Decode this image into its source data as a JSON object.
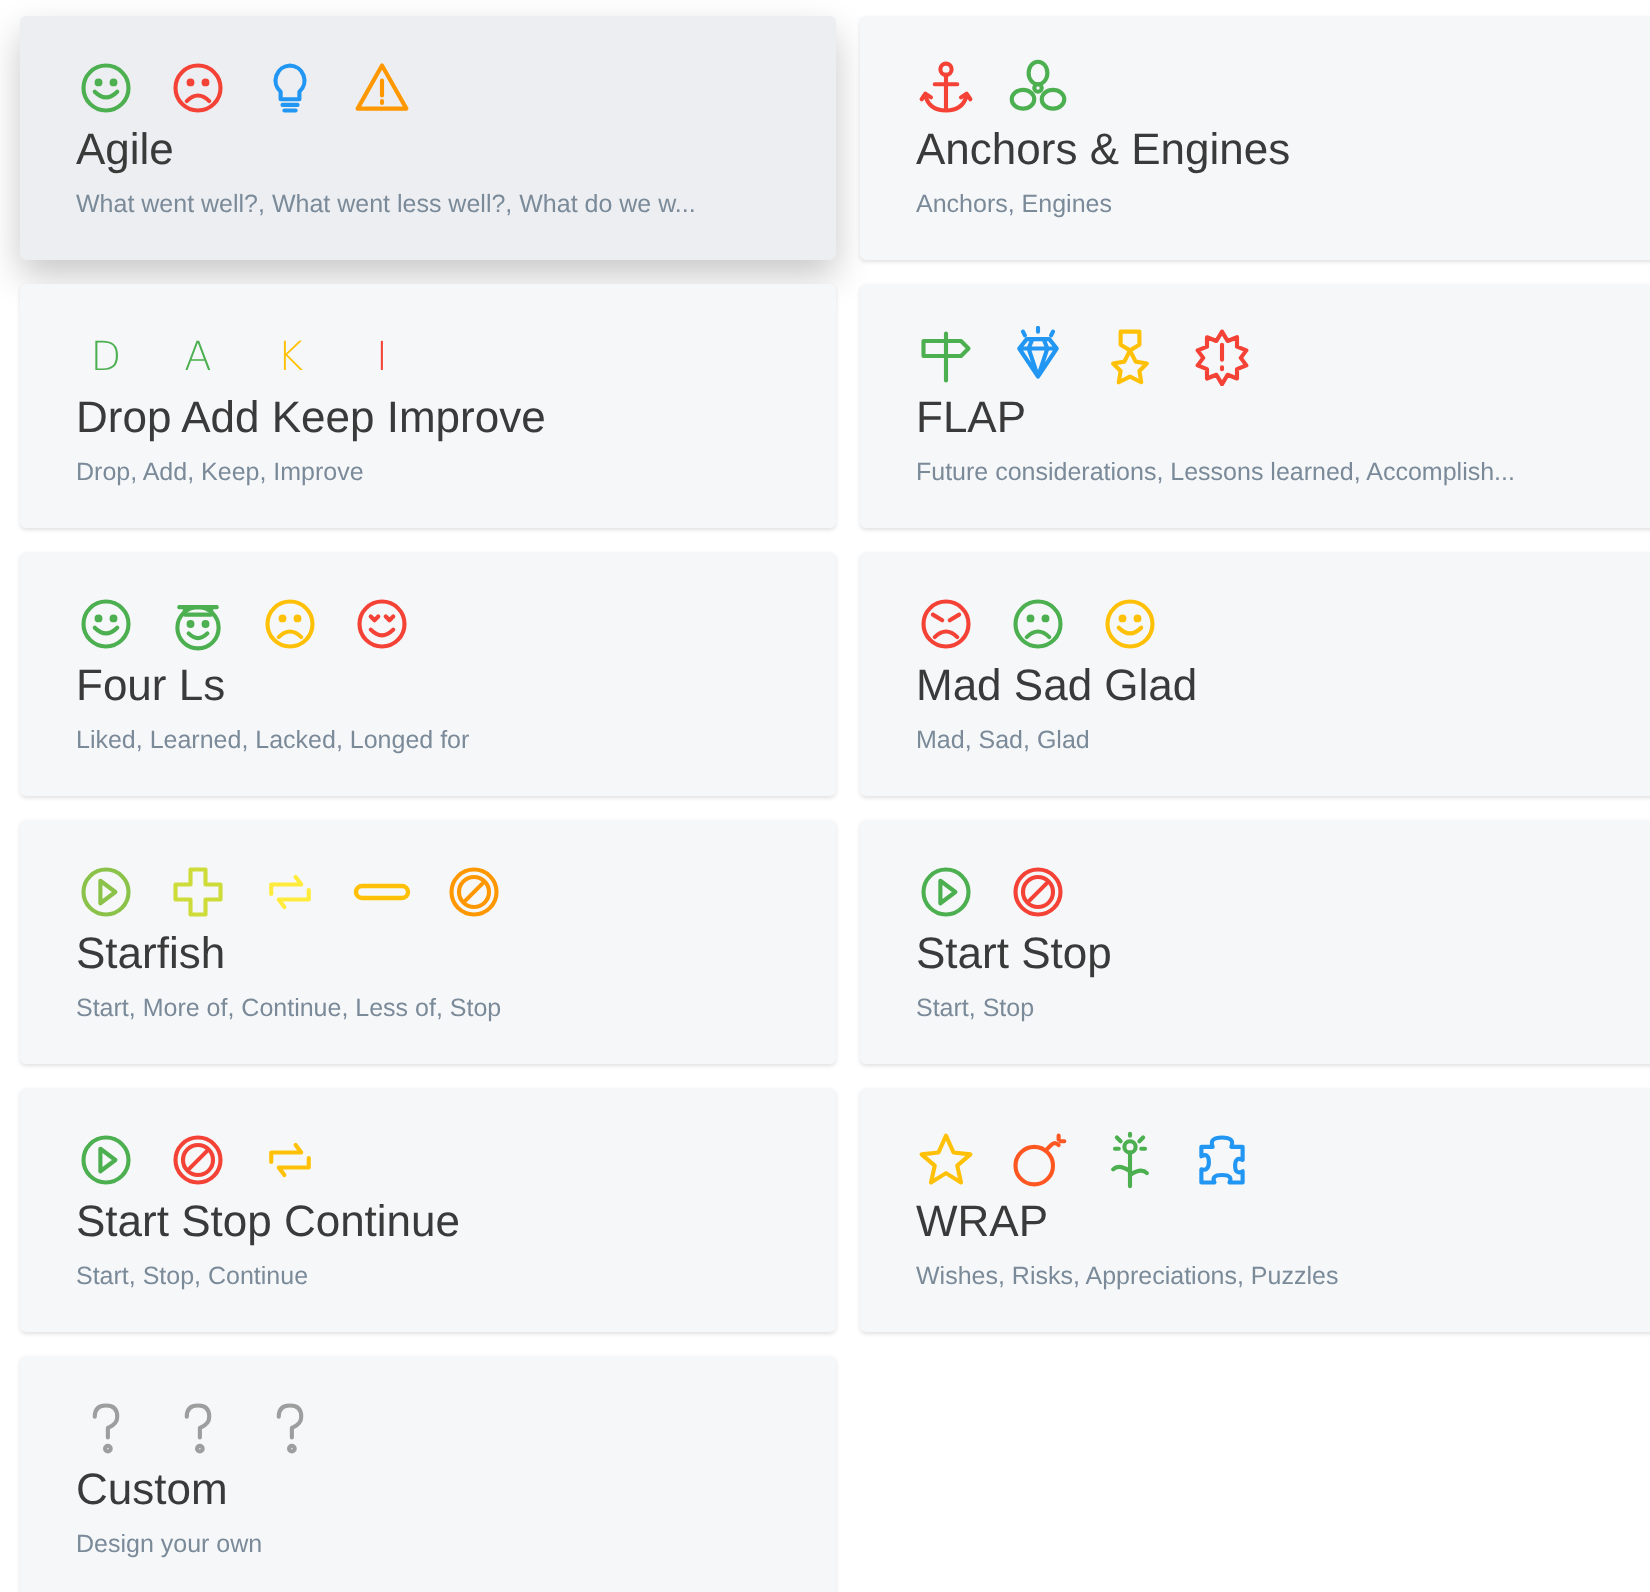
{
  "templates": [
    {
      "title": "Agile",
      "columns": "What went well?, What went less well?, What do we w...",
      "highlighted": true,
      "icons": [
        {
          "kind": "smile",
          "color": "#4caf50"
        },
        {
          "kind": "frown",
          "color": "#f44336"
        },
        {
          "kind": "bulb",
          "color": "#2196f3"
        },
        {
          "kind": "warning",
          "color": "#ff9800"
        }
      ]
    },
    {
      "title": "Anchors & Engines",
      "columns": "Anchors, Engines",
      "highlighted": false,
      "icons": [
        {
          "kind": "anchor",
          "color": "#f44336"
        },
        {
          "kind": "propeller",
          "color": "#4caf50"
        }
      ]
    },
    {
      "title": "Drop Add Keep Improve",
      "columns": "Drop, Add, Keep, Improve",
      "highlighted": false,
      "icons": [
        {
          "kind": "letter",
          "text": "D",
          "color": "#4caf50"
        },
        {
          "kind": "letter",
          "text": "A",
          "color": "#4caf50"
        },
        {
          "kind": "letter",
          "text": "K",
          "color": "#ffc107"
        },
        {
          "kind": "letter",
          "text": "I",
          "color": "#f44336"
        }
      ]
    },
    {
      "title": "FLAP",
      "columns": "Future considerations, Lessons learned, Accomplish...",
      "highlighted": false,
      "icons": [
        {
          "kind": "signpost",
          "color": "#4caf50"
        },
        {
          "kind": "diamond",
          "color": "#2196f3"
        },
        {
          "kind": "medal",
          "color": "#ffc107"
        },
        {
          "kind": "burst",
          "color": "#f44336"
        }
      ]
    },
    {
      "title": "Four Ls",
      "columns": "Liked, Learned, Lacked, Longed for",
      "highlighted": false,
      "icons": [
        {
          "kind": "smile",
          "color": "#4caf50"
        },
        {
          "kind": "graduate",
          "color": "#4caf50"
        },
        {
          "kind": "frown",
          "color": "#ffc107"
        },
        {
          "kind": "love",
          "color": "#f44336"
        }
      ]
    },
    {
      "title": "Mad Sad Glad",
      "columns": "Mad, Sad, Glad",
      "highlighted": false,
      "icons": [
        {
          "kind": "angry",
          "color": "#f44336"
        },
        {
          "kind": "frown",
          "color": "#4caf50"
        },
        {
          "kind": "smile",
          "color": "#ffc107"
        }
      ]
    },
    {
      "title": "Starfish",
      "columns": "Start, More of, Continue, Less of, Stop",
      "highlighted": false,
      "icons": [
        {
          "kind": "play",
          "color": "#8bc34a"
        },
        {
          "kind": "plus",
          "color": "#cddc39"
        },
        {
          "kind": "cycle",
          "color": "#ffeb3b"
        },
        {
          "kind": "minus",
          "color": "#ffc107"
        },
        {
          "kind": "stop",
          "color": "#ff9800"
        }
      ]
    },
    {
      "title": "Start Stop",
      "columns": "Start, Stop",
      "highlighted": false,
      "icons": [
        {
          "kind": "play",
          "color": "#4caf50"
        },
        {
          "kind": "stop",
          "color": "#f44336"
        }
      ]
    },
    {
      "title": "Start Stop Continue",
      "columns": "Start, Stop, Continue",
      "highlighted": false,
      "icons": [
        {
          "kind": "play",
          "color": "#4caf50"
        },
        {
          "kind": "stop",
          "color": "#f44336"
        },
        {
          "kind": "cycle",
          "color": "#ffc107"
        }
      ]
    },
    {
      "title": "WRAP",
      "columns": "Wishes, Risks, Appreciations, Puzzles",
      "highlighted": false,
      "icons": [
        {
          "kind": "star",
          "color": "#ffc107"
        },
        {
          "kind": "bomb",
          "color": "#ff5722"
        },
        {
          "kind": "flower",
          "color": "#4caf50"
        },
        {
          "kind": "puzzle",
          "color": "#2196f3"
        }
      ]
    },
    {
      "title": "Custom",
      "columns": "Design your own",
      "highlighted": false,
      "icons": [
        {
          "kind": "question",
          "color": "#9e9e9e"
        },
        {
          "kind": "question",
          "color": "#9e9e9e"
        },
        {
          "kind": "question",
          "color": "#9e9e9e"
        }
      ]
    }
  ]
}
